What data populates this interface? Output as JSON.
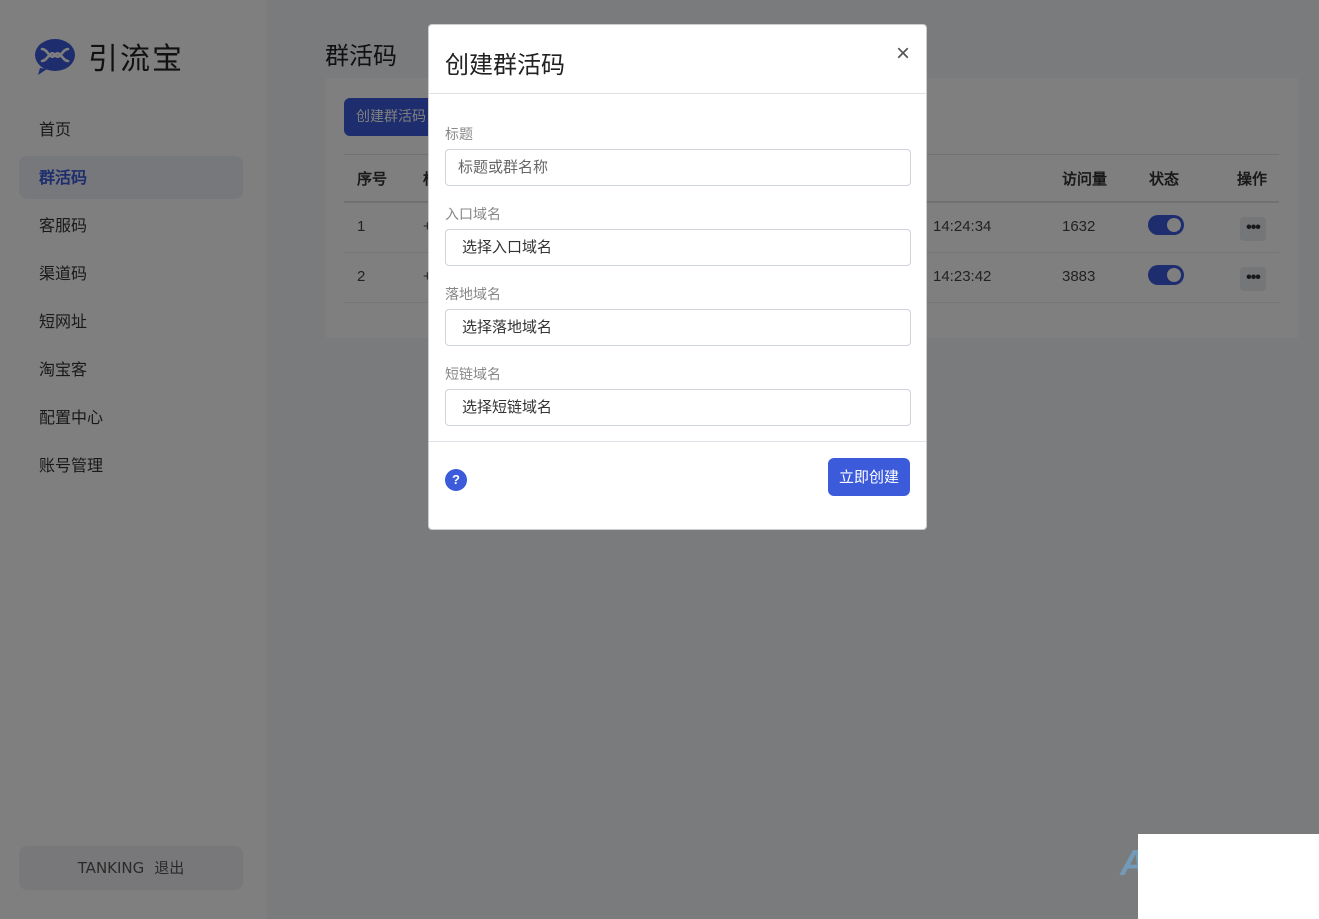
{
  "app": {
    "name": "引流宝"
  },
  "sidebar": {
    "items": [
      {
        "label": "首页"
      },
      {
        "label": "群活码"
      },
      {
        "label": "客服码"
      },
      {
        "label": "渠道码"
      },
      {
        "label": "短网址"
      },
      {
        "label": "淘宝客"
      },
      {
        "label": "配置中心"
      },
      {
        "label": "账号管理"
      }
    ],
    "active_index": 1,
    "user": {
      "name": "TANKING",
      "logout": "退出"
    }
  },
  "main": {
    "title": "群活码",
    "create_button": "创建群活码",
    "table": {
      "headers": {
        "index": "序号",
        "title": "标",
        "visits": "访问量",
        "status": "状态",
        "actions": "操作"
      },
      "rows": [
        {
          "index": "1",
          "title": "+",
          "time": "14:24:34",
          "visits": "1632",
          "status": "on"
        },
        {
          "index": "2",
          "title": "+",
          "time": "14:23:42",
          "visits": "3883",
          "status": "on"
        }
      ]
    }
  },
  "modal": {
    "title": "创建群活码",
    "fields": [
      {
        "label": "标题",
        "placeholder": "标题或群名称"
      },
      {
        "label": "入口域名",
        "value": "选择入口域名"
      },
      {
        "label": "落地域名",
        "value": "选择落地域名"
      },
      {
        "label": "短链域名",
        "value": "选择短链域名"
      }
    ],
    "help": "?",
    "submit": "立即创建",
    "close": "×"
  },
  "watermark": {
    "text": "A"
  },
  "colors": {
    "accent": "#3b5bdb"
  }
}
